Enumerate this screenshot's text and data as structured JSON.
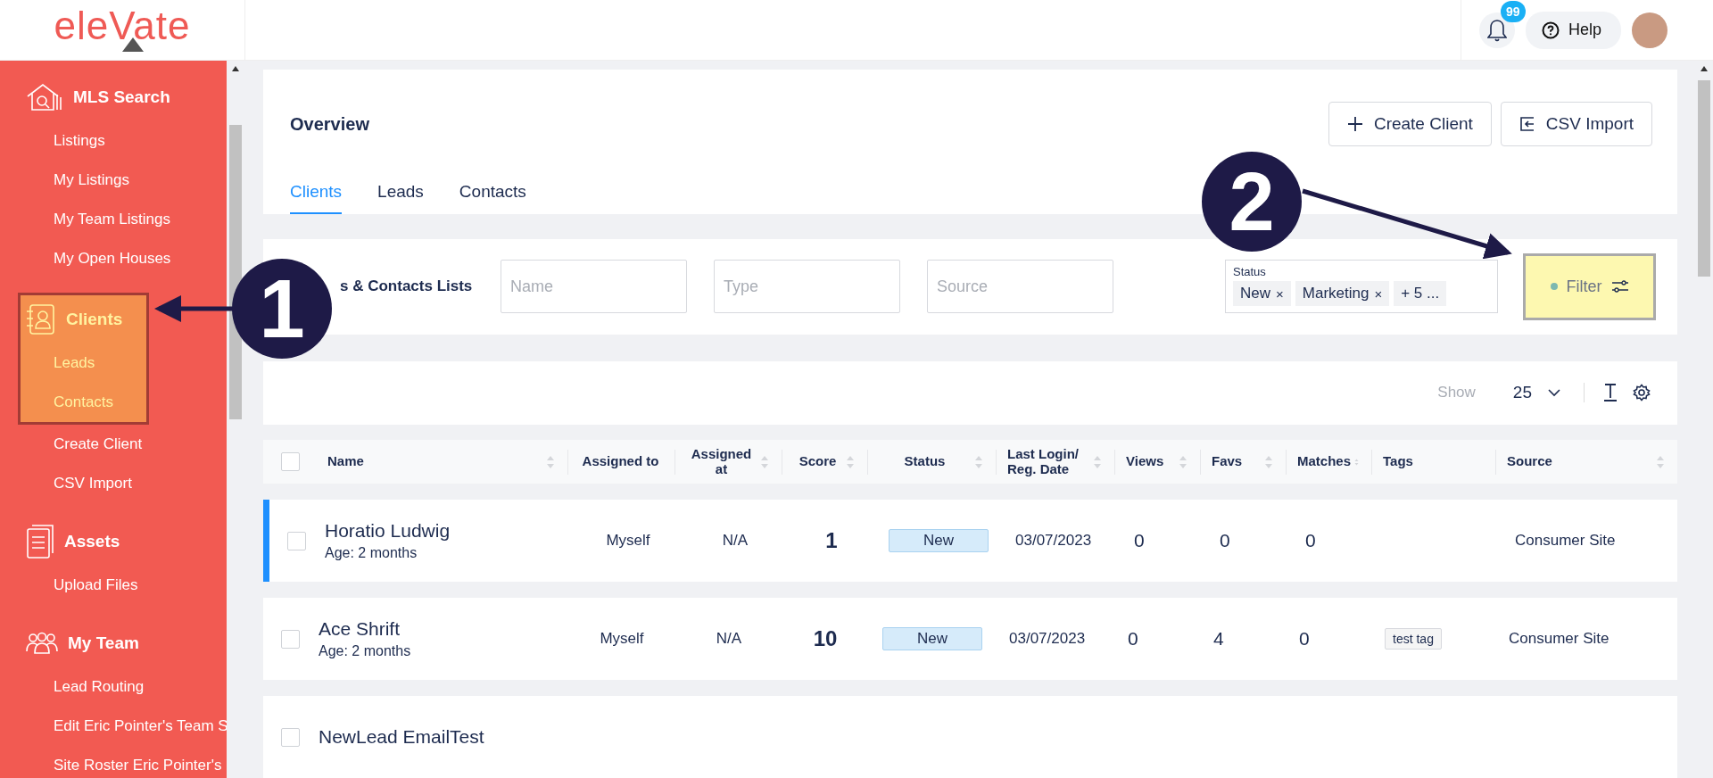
{
  "header": {
    "logo": "eleVate",
    "notifications_badge": "99",
    "help": "Help"
  },
  "sidebar": {
    "groups": [
      {
        "kind": "mls",
        "title": "MLS Search",
        "highlighted": false,
        "items": [
          {
            "label": "Listings",
            "highlighted": false
          },
          {
            "label": "My Listings",
            "highlighted": false
          },
          {
            "label": "My Team Listings",
            "highlighted": false
          },
          {
            "label": "My Open Houses",
            "highlighted": false
          }
        ]
      },
      {
        "kind": "clients",
        "title": "Clients",
        "highlighted": true,
        "items": [
          {
            "label": "Leads",
            "highlighted": true
          },
          {
            "label": "Contacts",
            "highlighted": true
          },
          {
            "label": "Create Client",
            "highlighted": false
          },
          {
            "label": "CSV Import",
            "highlighted": false
          }
        ]
      },
      {
        "kind": "assets",
        "title": "Assets",
        "highlighted": false,
        "items": [
          {
            "label": "Upload Files",
            "highlighted": false
          }
        ]
      },
      {
        "kind": "team",
        "title": "My Team",
        "highlighted": false,
        "items": [
          {
            "label": "Lead Routing",
            "highlighted": false
          },
          {
            "label": "Edit Eric Pointer's Team S",
            "highlighted": false
          },
          {
            "label": "Site Roster Eric Pointer's",
            "highlighted": false
          }
        ]
      }
    ]
  },
  "overview": {
    "title": "Overview",
    "buttons": [
      {
        "kind": "create",
        "label": "Create Client"
      },
      {
        "kind": "import",
        "label": "CSV Import"
      }
    ],
    "tabs": [
      {
        "label": "Clients",
        "selected": true
      },
      {
        "label": "Leads",
        "selected": false
      },
      {
        "label": "Contacts",
        "selected": false
      }
    ]
  },
  "filters": {
    "list_title": "s & Contacts Lists",
    "fields": [
      {
        "placeholder": "Name"
      },
      {
        "placeholder": "Type"
      },
      {
        "placeholder": "Source"
      }
    ],
    "status": {
      "label": "Status",
      "chips": [
        {
          "label": "New",
          "remove": "×"
        },
        {
          "label": "Marketing",
          "remove": "×"
        },
        {
          "label": "+ 5 ..."
        }
      ]
    },
    "filter_button": {
      "label": "Filter",
      "highlighted": true
    }
  },
  "table": {
    "show_label": "Show",
    "page_size": "25",
    "select_all_checked": false,
    "columns": [
      {
        "label": "Name",
        "sortable": true
      },
      {
        "label": "Assigned to",
        "sortable": false
      },
      {
        "label": "Assigned at",
        "sortable": true
      },
      {
        "label": "Score",
        "sortable": true
      },
      {
        "label": "Status",
        "sortable": true
      },
      {
        "label": "Last Login/\nReg. Date",
        "sortable": true
      },
      {
        "label": "Views",
        "sortable": true
      },
      {
        "label": "Favs",
        "sortable": true
      },
      {
        "label": "Matches",
        "sortable": true
      },
      {
        "label": "Tags",
        "sortable": false
      },
      {
        "label": "Source",
        "sortable": true
      }
    ],
    "rows": [
      {
        "selected": true,
        "checked": false,
        "name": "Horatio Ludwig",
        "age": "Age: 2 months",
        "assigned_to": "Myself",
        "assigned_at": "N/A",
        "score": "1",
        "status": "New",
        "date": "03/07/2023",
        "views": "0",
        "favs": "0",
        "matches": "0",
        "tags": [],
        "source": "Consumer Site"
      },
      {
        "selected": false,
        "checked": false,
        "name": "Ace Shrift",
        "age": "Age: 2 months",
        "assigned_to": "Myself",
        "assigned_at": "N/A",
        "score": "10",
        "status": "New",
        "date": "03/07/2023",
        "views": "0",
        "favs": "4",
        "matches": "0",
        "tags": [
          "test tag"
        ],
        "source": "Consumer Site"
      },
      {
        "selected": false,
        "checked": false,
        "name": "NewLead EmailTest"
      }
    ]
  },
  "annotations": [
    {
      "label": "1"
    },
    {
      "label": "2"
    }
  ]
}
